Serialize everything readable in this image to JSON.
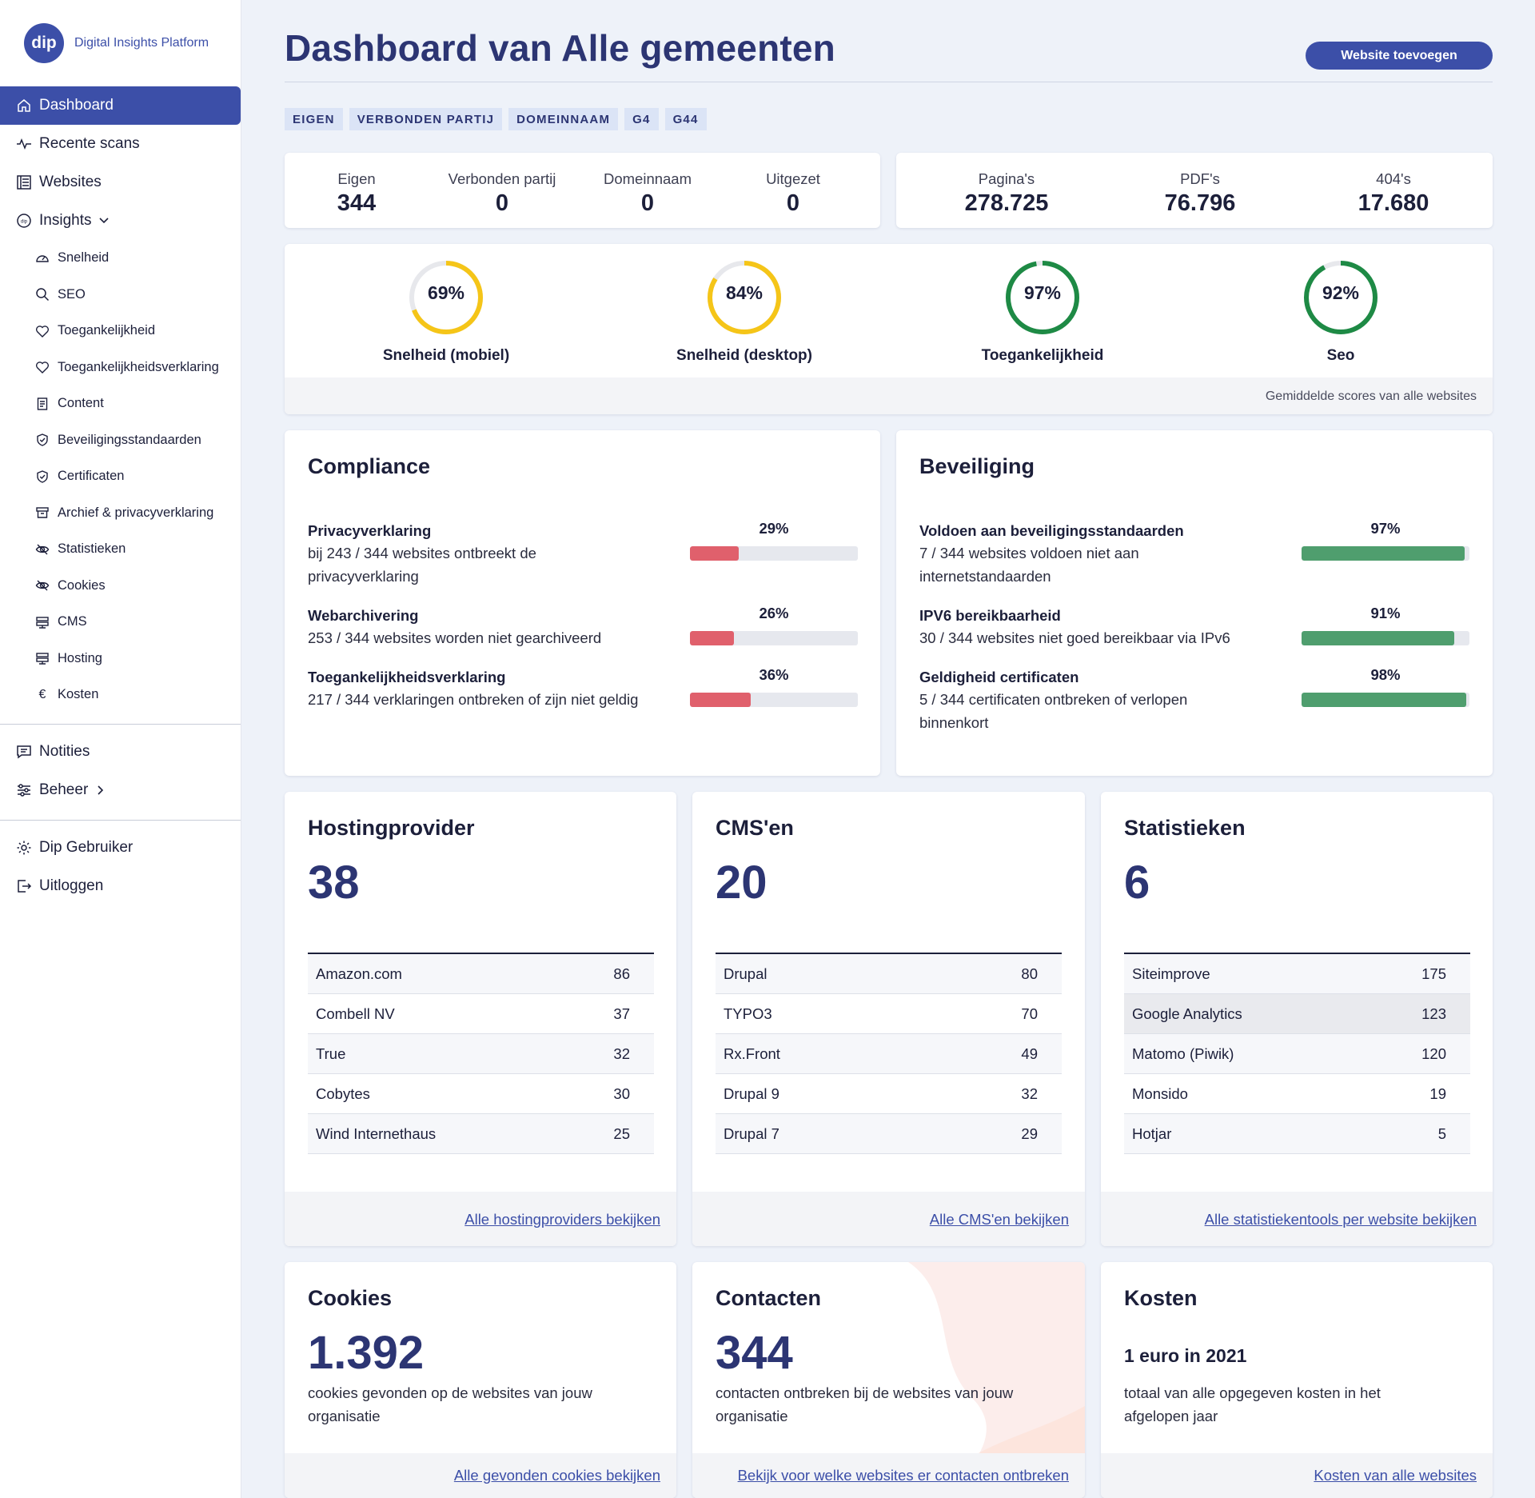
{
  "brand": {
    "logo": "dip",
    "name": "Digital Insights Platform"
  },
  "nav": {
    "dashboard": "Dashboard",
    "recent_scans": "Recente scans",
    "websites": "Websites",
    "insights": "Insights",
    "sub": [
      "Snelheid",
      "SEO",
      "Toegankelijkheid",
      "Toegankelijkheidsverklaring",
      "Content",
      "Beveiligingsstandaarden",
      "Certificaten",
      "Archief & privacyverklaring",
      "Statistieken",
      "Cookies",
      "CMS",
      "Hosting",
      "Kosten"
    ],
    "notes": "Notities",
    "manage": "Beheer",
    "user": "Dip Gebruiker",
    "logout": "Uitloggen"
  },
  "header": {
    "title": "Dashboard van Alle gemeenten",
    "add_button": "Website toevoegen"
  },
  "chips": [
    "EIGEN",
    "VERBONDEN PARTIJ",
    "DOMEINNAAM",
    "G4",
    "G44"
  ],
  "counts": [
    {
      "label": "Eigen",
      "value": "344"
    },
    {
      "label": "Verbonden partij",
      "value": "0"
    },
    {
      "label": "Domeinnaam",
      "value": "0"
    },
    {
      "label": "Uitgezet",
      "value": "0"
    }
  ],
  "pages": [
    {
      "label": "Pagina's",
      "value": "278.725"
    },
    {
      "label": "PDF's",
      "value": "76.796"
    },
    {
      "label": "404's",
      "value": "17.680"
    }
  ],
  "scores": {
    "items": [
      {
        "label": "Snelheid (mobiel)",
        "value": "69%",
        "fraction": 0.69,
        "color": "#f5c518"
      },
      {
        "label": "Snelheid (desktop)",
        "value": "84%",
        "fraction": 0.84,
        "color": "#f5c518"
      },
      {
        "label": "Toegankelijkheid",
        "value": "97%",
        "fraction": 0.97,
        "color": "#1e8a45"
      },
      {
        "label": "Seo",
        "value": "92%",
        "fraction": 0.92,
        "color": "#1e8a45"
      }
    ],
    "footer": "Gemiddelde scores van alle websites"
  },
  "compliance": {
    "title": "Compliance",
    "items": [
      {
        "title": "Privacyverklaring",
        "desc": "bij 243 / 344 websites ontbreekt de privacyverklaring",
        "pct": "29%",
        "fraction": 0.29
      },
      {
        "title": "Webarchivering",
        "desc": "253 / 344 websites worden niet gearchiveerd",
        "pct": "26%",
        "fraction": 0.26
      },
      {
        "title": "Toegankelijkheidsverklaring",
        "desc": "217 / 344 verklaringen ontbreken of zijn niet geldig",
        "pct": "36%",
        "fraction": 0.36
      }
    ],
    "bar_color": "#e0606c"
  },
  "security": {
    "title": "Beveiliging",
    "items": [
      {
        "title": "Voldoen aan beveiligingsstandaarden",
        "desc": "7 / 344 websites voldoen niet aan internetstandaarden",
        "pct": "97%",
        "fraction": 0.97
      },
      {
        "title": "IPV6 bereikbaarheid",
        "desc": "30 / 344 websites niet goed bereikbaar via IPv6",
        "pct": "91%",
        "fraction": 0.91
      },
      {
        "title": "Geldigheid certificaten",
        "desc": "5 / 344 certificaten ontbreken of verlopen binnenkort",
        "pct": "98%",
        "fraction": 0.98
      }
    ],
    "bar_color": "#4f9e6e"
  },
  "hosting": {
    "title": "Hostingprovider",
    "count": "38",
    "rows": [
      [
        "Amazon.com",
        "86"
      ],
      [
        "Combell NV",
        "37"
      ],
      [
        "True",
        "32"
      ],
      [
        "Cobytes",
        "30"
      ],
      [
        "Wind Internethaus",
        "25"
      ]
    ],
    "link": "Alle hostingproviders bekijken"
  },
  "cms": {
    "title": "CMS'en",
    "count": "20",
    "rows": [
      [
        "Drupal",
        "80"
      ],
      [
        "TYPO3",
        "70"
      ],
      [
        "Rx.Front",
        "49"
      ],
      [
        "Drupal 9",
        "32"
      ],
      [
        "Drupal 7",
        "29"
      ]
    ],
    "link": "Alle CMS'en bekijken"
  },
  "stats": {
    "title": "Statistieken",
    "count": "6",
    "rows": [
      [
        "Siteimprove",
        "175"
      ],
      [
        "Google Analytics",
        "123"
      ],
      [
        "Matomo (Piwik)",
        "120"
      ],
      [
        "Monsido",
        "19"
      ],
      [
        "Hotjar",
        "5"
      ]
    ],
    "link": "Alle statistiekentools per website bekijken"
  },
  "cookies": {
    "title": "Cookies",
    "count": "1.392",
    "desc": "cookies gevonden op de websites van jouw organisatie",
    "link": "Alle gevonden cookies bekijken"
  },
  "contacts": {
    "title": "Contacten",
    "count": "344",
    "desc": "contacten ontbreken bij de websites van jouw organisatie",
    "link": "Bekijk voor welke websites er contacten ontbreken"
  },
  "costs": {
    "title": "Kosten",
    "subtitle": "1 euro in 2021",
    "desc": "totaal van alle opgegeven kosten in het afgelopen jaar",
    "link": "Kosten van alle websites"
  },
  "colors": {
    "accent": "#3c4fa8",
    "title": "#2c3573"
  }
}
